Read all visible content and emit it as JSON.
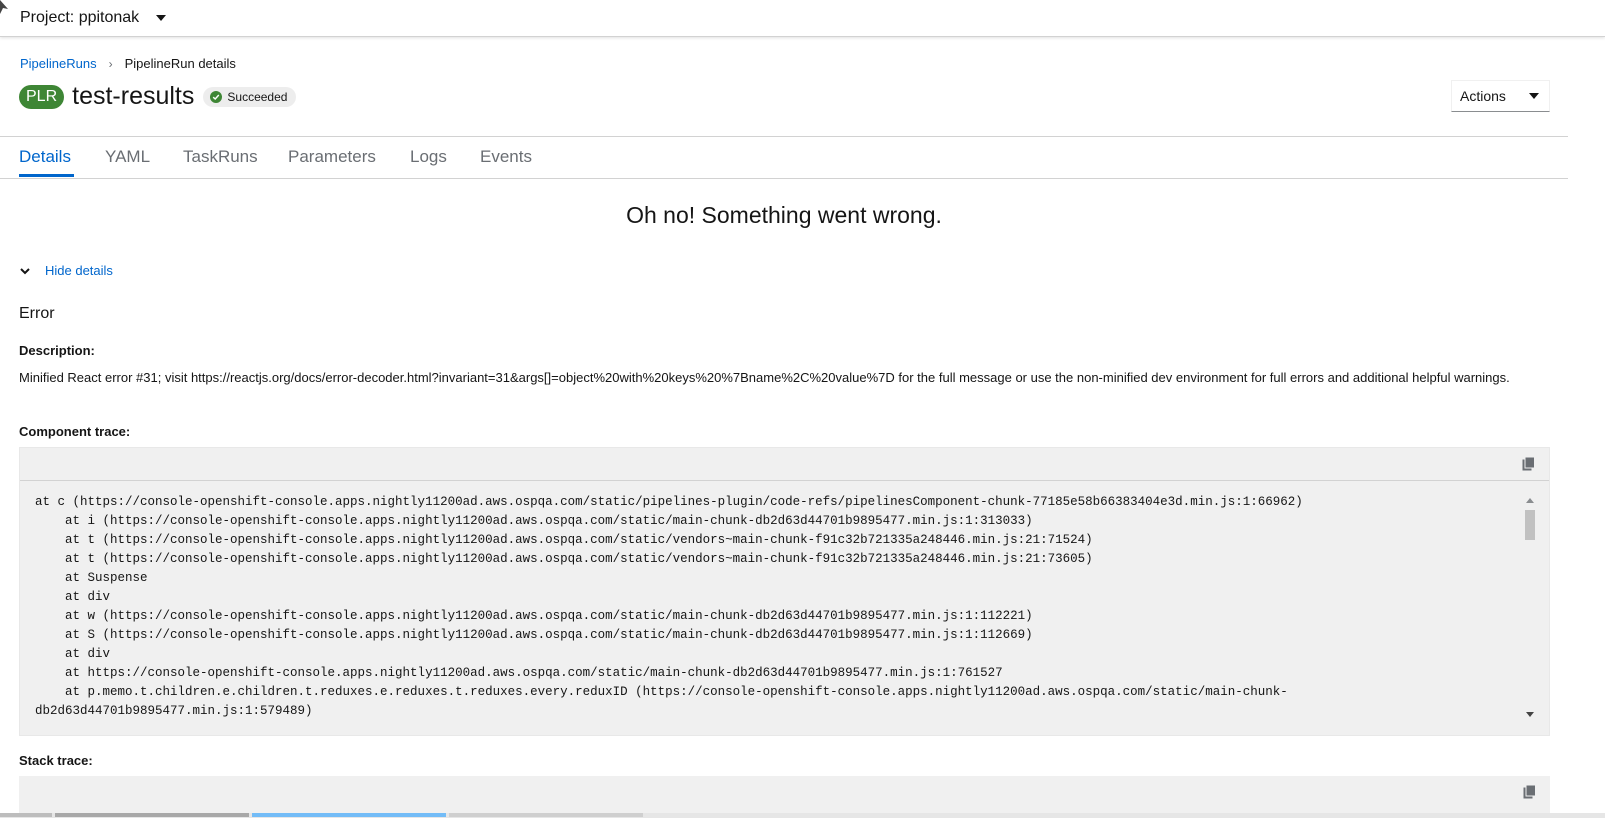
{
  "topbar": {
    "project_label": "Project: ppitonak"
  },
  "breadcrumb": {
    "link": "PipelineRuns",
    "current": "PipelineRun details"
  },
  "header": {
    "badge": "PLR",
    "title": "test-results",
    "status": "Succeeded",
    "actions_label": "Actions",
    "status_color": "#3e8635"
  },
  "tabs": [
    "Details",
    "YAML",
    "TaskRuns",
    "Parameters",
    "Logs",
    "Events"
  ],
  "error": {
    "heading": "Oh no! Something went wrong.",
    "toggle_label": "Hide details",
    "section_title": "Error",
    "description_label": "Description:",
    "description": "Minified React error #31; visit https://reactjs.org/docs/error-decoder.html?invariant=31&args[]=object%20with%20keys%20%7Bname%2C%20value%7D for the full message or use the non-minified dev environment for full errors and additional helpful warnings.",
    "component_trace_label": "Component trace:",
    "component_trace": [
      "at c (https://console-openshift-console.apps.nightly11200ad.aws.ospqa.com/static/pipelines-plugin/code-refs/pipelinesComponent-chunk-77185e58b66383404e3d.min.js:1:66962)",
      "    at i (https://console-openshift-console.apps.nightly11200ad.aws.ospqa.com/static/main-chunk-db2d63d44701b9895477.min.js:1:313033)",
      "    at t (https://console-openshift-console.apps.nightly11200ad.aws.ospqa.com/static/vendors~main-chunk-f91c32b721335a248446.min.js:21:71524)",
      "    at t (https://console-openshift-console.apps.nightly11200ad.aws.ospqa.com/static/vendors~main-chunk-f91c32b721335a248446.min.js:21:73605)",
      "    at Suspense",
      "    at div",
      "    at w (https://console-openshift-console.apps.nightly11200ad.aws.ospqa.com/static/main-chunk-db2d63d44701b9895477.min.js:1:112221)",
      "    at S (https://console-openshift-console.apps.nightly11200ad.aws.ospqa.com/static/main-chunk-db2d63d44701b9895477.min.js:1:112669)",
      "    at div",
      "    at https://console-openshift-console.apps.nightly11200ad.aws.ospqa.com/static/main-chunk-db2d63d44701b9895477.min.js:1:761527",
      "    at p.memo.t.children.e.children.t.reduxes.e.reduxes.t.reduxes.every.reduxID (https://console-openshift-console.apps.nightly11200ad.aws.ospqa.com/static/main-chunk-",
      "db2d63d44701b9895477.min.js:1:579489)"
    ],
    "stack_trace_label": "Stack trace:"
  },
  "icons": {
    "project_dropdown": "caret-down-icon",
    "actions_dropdown": "caret-down-icon",
    "status": "check-circle-icon",
    "toggle": "chevron-down-icon",
    "copy": "copy-icon"
  },
  "colors": {
    "link": "#0066cc",
    "success": "#3e8635",
    "code_bg": "#f0f0f0"
  }
}
